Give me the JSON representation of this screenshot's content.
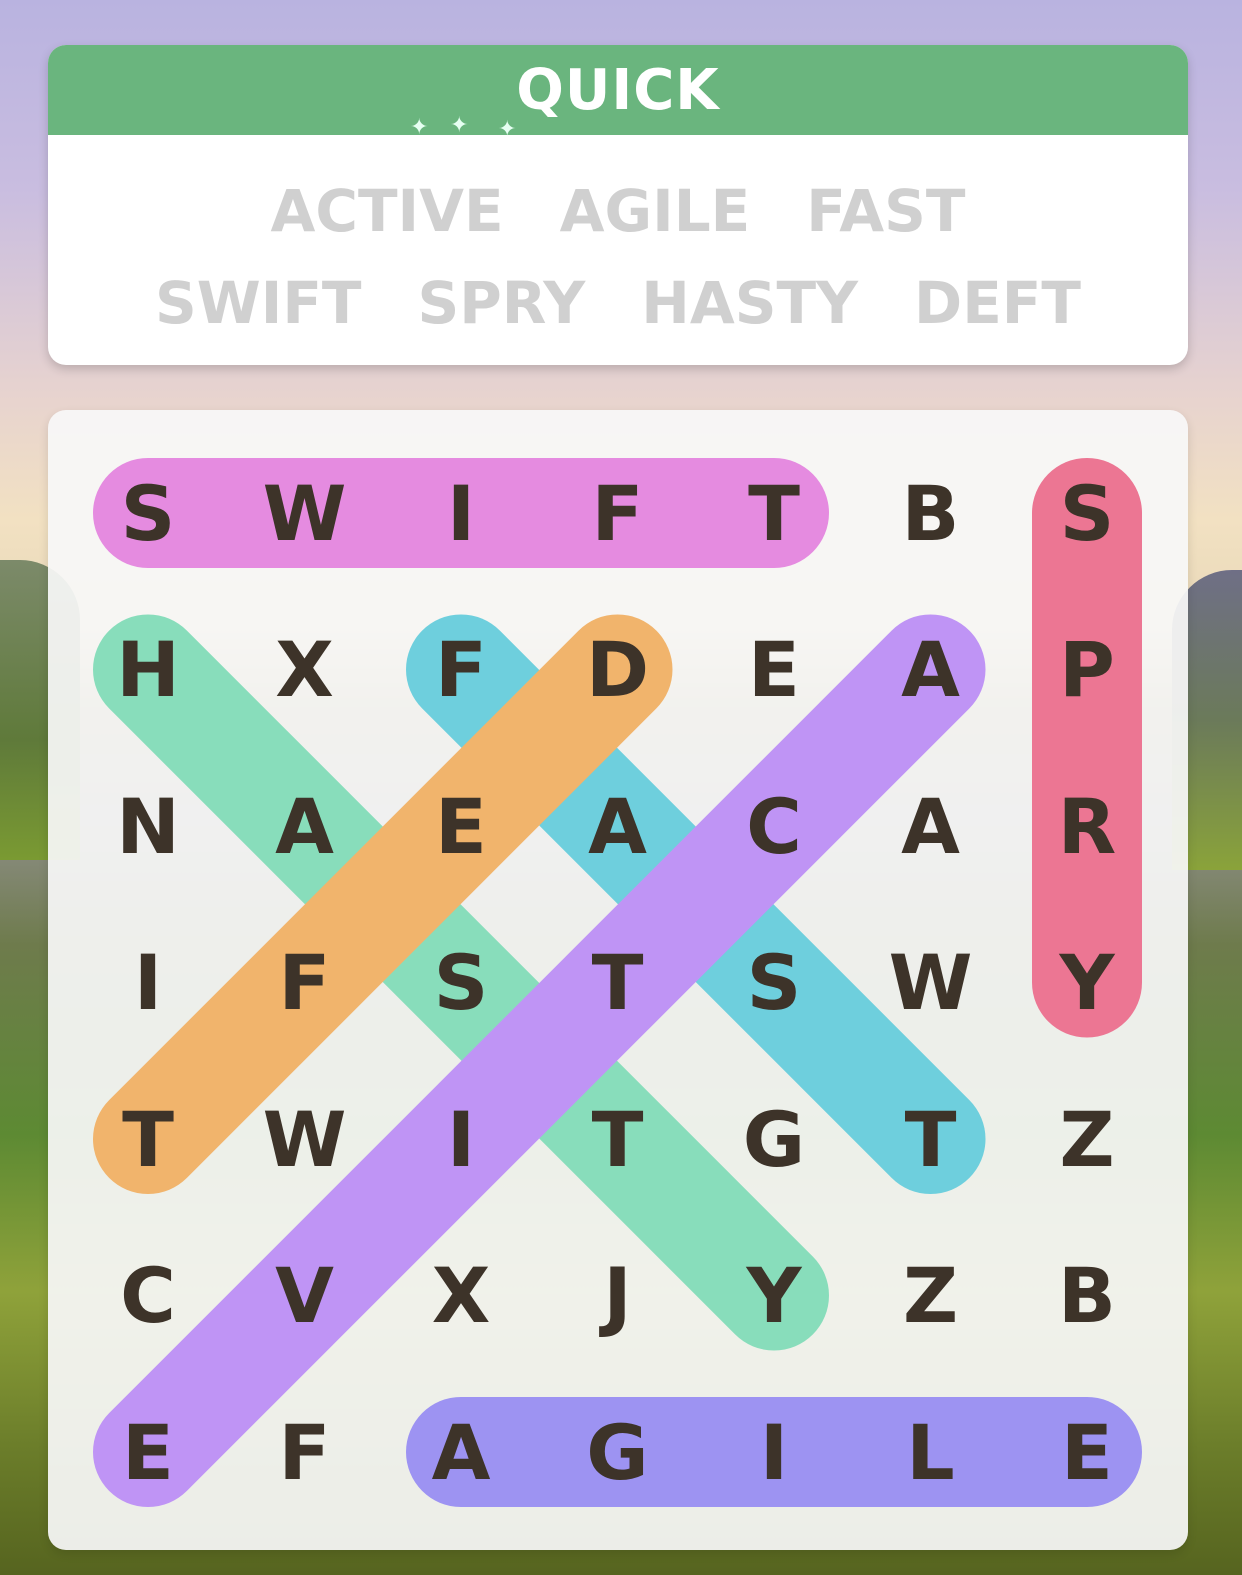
{
  "header": {
    "title": "QUICK"
  },
  "words": {
    "row1": [
      "ACTIVE",
      "AGILE",
      "FAST"
    ],
    "row2": [
      "SWIFT",
      "SPRY",
      "HASTY",
      "DEFT"
    ]
  },
  "grid": {
    "rows": [
      [
        "S",
        "W",
        "I",
        "F",
        "T",
        "B",
        "S"
      ],
      [
        "H",
        "X",
        "F",
        "D",
        "E",
        "A",
        "P"
      ],
      [
        "N",
        "A",
        "E",
        "A",
        "C",
        "A",
        "R"
      ],
      [
        "I",
        "F",
        "S",
        "T",
        "S",
        "W",
        "Y"
      ],
      [
        "T",
        "W",
        "I",
        "T",
        "G",
        "T",
        "Z"
      ],
      [
        "C",
        "V",
        "X",
        "J",
        "Y",
        "Z",
        "B"
      ],
      [
        "E",
        "F",
        "A",
        "G",
        "I",
        "L",
        "E"
      ]
    ]
  },
  "found_words": [
    {
      "word": "SWIFT",
      "color": "#e58be0",
      "from": [
        0,
        0
      ],
      "to": [
        0,
        4
      ]
    },
    {
      "word": "SPRY",
      "color": "#ec7693",
      "from": [
        0,
        6
      ],
      "to": [
        3,
        6
      ]
    },
    {
      "word": "HASTY",
      "color": "#88ddbb",
      "from": [
        1,
        0
      ],
      "to": [
        5,
        4
      ]
    },
    {
      "word": "FAST",
      "color": "#6ecfdd",
      "from": [
        1,
        2
      ],
      "to": [
        4,
        5
      ]
    },
    {
      "word": "DEFT",
      "color": "#f1b46c",
      "from": [
        1,
        3
      ],
      "to": [
        4,
        0
      ]
    },
    {
      "word": "ACTIVE",
      "color": "#bf94f5",
      "from": [
        1,
        5
      ],
      "to": [
        6,
        0
      ]
    },
    {
      "word": "AGILE",
      "color": "#9d93f2",
      "from": [
        6,
        2
      ],
      "to": [
        6,
        6
      ]
    }
  ]
}
